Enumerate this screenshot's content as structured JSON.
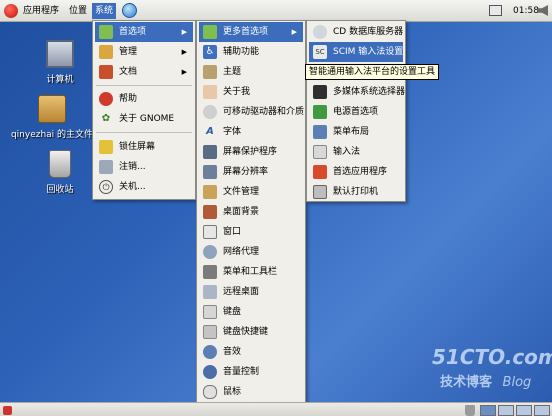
{
  "top_panel": {
    "applications": "应用程序",
    "places": "位置",
    "system": "系统",
    "clock": "01:58"
  },
  "desktop": {
    "icons": [
      {
        "label": "计算机"
      },
      {
        "label": "qinyezhai 的主文件"
      },
      {
        "label": "回收站"
      }
    ]
  },
  "system_menu": {
    "items": [
      {
        "label": "首选项",
        "icon": "preferences-icon"
      },
      {
        "label": "管理",
        "icon": "admin-icon"
      },
      {
        "label": "文档",
        "icon": "documents-icon"
      },
      {
        "label": "帮助",
        "icon": "help-icon"
      },
      {
        "label": "关于 GNOME",
        "icon": "gnome-icon"
      },
      {
        "label": "锁住屏幕",
        "icon": "lock-icon"
      },
      {
        "label": "注销...",
        "icon": "logout-icon"
      },
      {
        "label": "关机...",
        "icon": "shutdown-icon"
      }
    ]
  },
  "preferences_menu": {
    "items": [
      {
        "label": "更多首选项",
        "icon": "more-preferences-icon"
      },
      {
        "label": "辅助功能",
        "icon": "accessibility-icon"
      },
      {
        "label": "主题",
        "icon": "theme-icon"
      },
      {
        "label": "关于我",
        "icon": "about-me-icon"
      },
      {
        "label": "可移动驱动器和介质",
        "icon": "removable-media-icon"
      },
      {
        "label": "字体",
        "icon": "font-icon"
      },
      {
        "label": "屏幕保护程序",
        "icon": "screensaver-icon"
      },
      {
        "label": "屏幕分辨率",
        "icon": "resolution-icon"
      },
      {
        "label": "文件管理",
        "icon": "file-management-icon"
      },
      {
        "label": "桌面背景",
        "icon": "desktop-background-icon"
      },
      {
        "label": "窗口",
        "icon": "windows-icon"
      },
      {
        "label": "网络代理",
        "icon": "network-proxy-icon"
      },
      {
        "label": "菜单和工具栏",
        "icon": "menus-toolbars-icon"
      },
      {
        "label": "远程桌面",
        "icon": "remote-desktop-icon"
      },
      {
        "label": "键盘",
        "icon": "keyboard-icon"
      },
      {
        "label": "键盘快捷键",
        "icon": "keyboard-shortcuts-icon"
      },
      {
        "label": "音效",
        "icon": "sound-icon"
      },
      {
        "label": "音量控制",
        "icon": "volume-icon"
      },
      {
        "label": "鼠标",
        "icon": "mouse-icon"
      }
    ]
  },
  "more_preferences_menu": {
    "items": [
      {
        "label": "CD 数据库服务器",
        "icon": "cd-database-icon"
      },
      {
        "label": "SCIM 输入法设置",
        "icon": "scim-icon"
      },
      {
        "label": "多媒体系统选择器",
        "icon": "multimedia-icon"
      },
      {
        "label": "电源首选项",
        "icon": "power-icon"
      },
      {
        "label": "菜单布局",
        "icon": "menu-layout-icon"
      },
      {
        "label": "输入法",
        "icon": "input-method-icon"
      },
      {
        "label": "首选应用程序",
        "icon": "preferred-apps-icon"
      },
      {
        "label": "默认打印机",
        "icon": "printer-icon"
      }
    ]
  },
  "tooltip": "智能通用输入法平台的设置工具",
  "watermark": {
    "site": "51CTO.com",
    "subtitle": "技术博客",
    "tag": "Blog"
  }
}
